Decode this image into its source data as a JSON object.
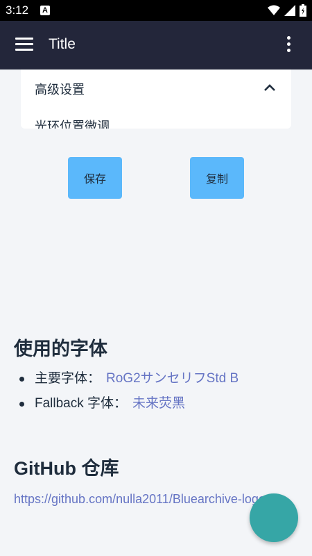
{
  "status_bar": {
    "time": "3:12",
    "notification_icon": "A"
  },
  "app_bar": {
    "title": "Title"
  },
  "advanced_settings": {
    "title": "高级设置",
    "expanded": true,
    "partial_item": "光环位置微调"
  },
  "buttons": {
    "save_label": "保存",
    "copy_label": "复制"
  },
  "fonts_section": {
    "heading": "使用的字体",
    "items": [
      {
        "label": "主要字体：",
        "value": "RoG2サンセリフStd B"
      },
      {
        "label": "Fallback 字体：",
        "value": "未来荧黑"
      }
    ]
  },
  "github_section": {
    "heading": "GitHub 仓库",
    "url": "https://github.com/nulla2011/Bluearchive-logo"
  },
  "colors": {
    "app_bar": "#23263a",
    "button": "#5bb8fb",
    "link": "#6574c4",
    "fab": "#36a6a6",
    "background": "#f3f5f8"
  }
}
